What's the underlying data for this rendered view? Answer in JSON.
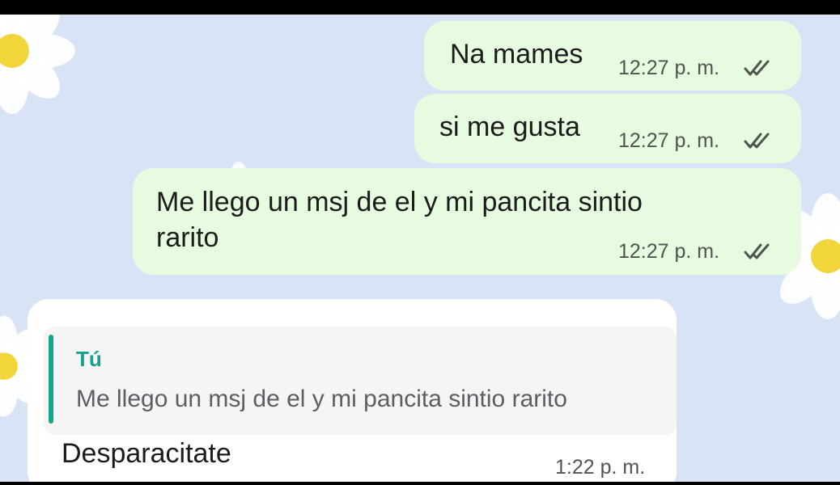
{
  "chat": {
    "messages": [
      {
        "direction": "outgoing",
        "text": "Na mames",
        "time": "12:27 p. m.",
        "status_icon": "double-check-icon"
      },
      {
        "direction": "outgoing",
        "text": "si me gusta",
        "time": "12:27 p. m.",
        "status_icon": "double-check-icon"
      },
      {
        "direction": "outgoing",
        "text_line_1": "Me llego un msj de el y mi pancita sintio",
        "text_line_2": "rarito",
        "time": "12:27 p. m.",
        "status_icon": "double-check-icon"
      },
      {
        "direction": "incoming",
        "reply": {
          "author": "Tú",
          "text": "Me llego un msj de el y mi pancita sintio rarito"
        },
        "text": "Desparacitate",
        "time": "1:22 p. m."
      }
    ]
  },
  "colors": {
    "chat_background": "#d9e3f6",
    "outgoing_bubble": "#e6fbdf",
    "incoming_bubble": "#ffffff",
    "reply_accent": "#17a58c",
    "read_ticks": "#4f5550"
  }
}
